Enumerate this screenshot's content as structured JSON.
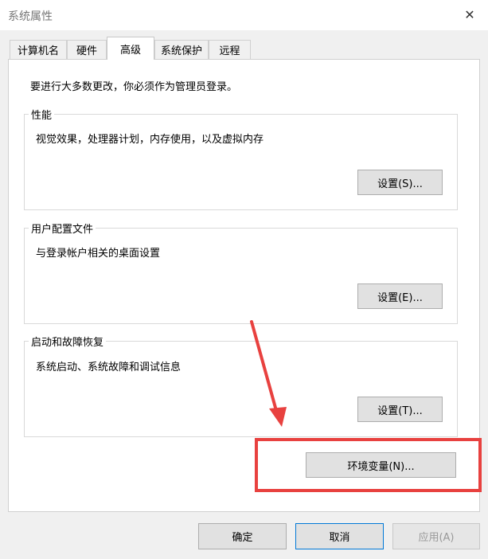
{
  "window": {
    "title": "系统属性"
  },
  "tabs": [
    {
      "label": "计算机名"
    },
    {
      "label": "硬件"
    },
    {
      "label": "高级",
      "active": true
    },
    {
      "label": "系统保护"
    },
    {
      "label": "远程"
    }
  ],
  "notice": "要进行大多数更改，你必须作为管理员登录。",
  "groups": {
    "performance": {
      "title": "性能",
      "desc": "视觉效果，处理器计划，内存使用，以及虚拟内存",
      "button": "设置(S)..."
    },
    "user_profiles": {
      "title": "用户配置文件",
      "desc": "与登录帐户相关的桌面设置",
      "button": "设置(E)..."
    },
    "startup_recovery": {
      "title": "启动和故障恢复",
      "desc": "系统启动、系统故障和调试信息",
      "button": "设置(T)..."
    }
  },
  "env_button": "环境变量(N)...",
  "footer": {
    "ok": "确定",
    "cancel": "取消",
    "apply": "应用(A)"
  },
  "colors": {
    "annotation": "#e8413f"
  }
}
